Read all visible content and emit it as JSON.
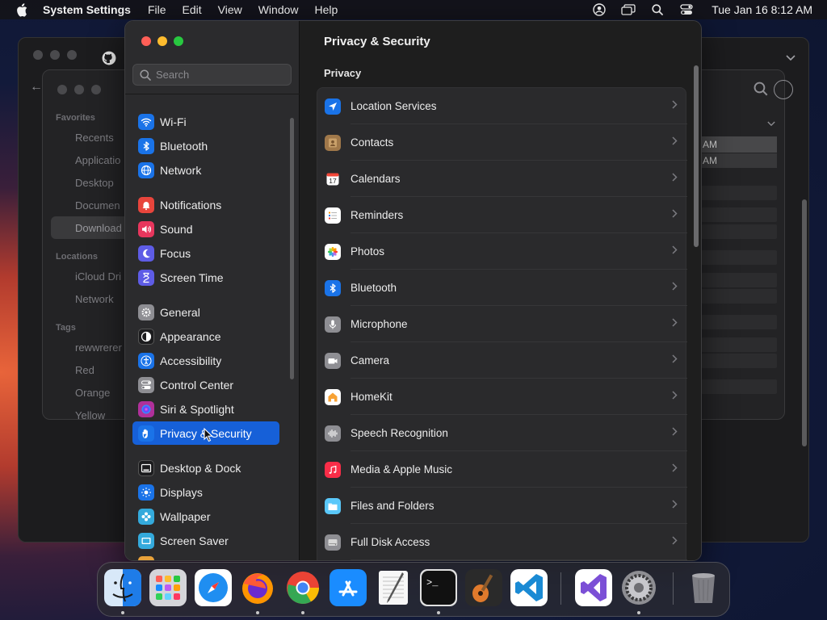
{
  "menubar": {
    "app_name": "System Settings",
    "menus": [
      "File",
      "Edit",
      "View",
      "Window",
      "Help"
    ],
    "clock": "Tue Jan 16  8:12 AM"
  },
  "background_finder": {
    "sidebar": [
      {
        "kind": "header",
        "label": "Favorites"
      },
      {
        "kind": "item",
        "label": "Recents"
      },
      {
        "kind": "item",
        "label": "Applicatio"
      },
      {
        "kind": "item",
        "label": "Desktop"
      },
      {
        "kind": "item",
        "label": "Documen"
      },
      {
        "kind": "item",
        "label": "Download"
      },
      {
        "kind": "header",
        "label": "Locations"
      },
      {
        "kind": "item",
        "label": "iCloud Dri"
      },
      {
        "kind": "item",
        "label": "Network"
      },
      {
        "kind": "header",
        "label": "Tags"
      },
      {
        "kind": "item",
        "label": "rewwrerer"
      },
      {
        "kind": "item",
        "label": "Red"
      },
      {
        "kind": "item",
        "label": "Orange"
      },
      {
        "kind": "item",
        "label": "Yellow"
      }
    ],
    "list_times": [
      "AM",
      "AM"
    ]
  },
  "settings": {
    "search_placeholder": "Search",
    "sidebar": [
      {
        "label": "Wi-Fi",
        "icon": "wifi-icon",
        "color": "#1a73e8"
      },
      {
        "label": "Bluetooth",
        "icon": "bluetooth-icon",
        "color": "#1a73e8"
      },
      {
        "label": "Network",
        "icon": "network-icon",
        "color": "#1a73e8"
      },
      {
        "label": "Notifications",
        "icon": "notifications-icon",
        "color": "#e8453c"
      },
      {
        "label": "Sound",
        "icon": "sound-icon",
        "color": "#e8365d"
      },
      {
        "label": "Focus",
        "icon": "focus-icon",
        "color": "#5e5ce6"
      },
      {
        "label": "Screen Time",
        "icon": "screen-time-icon",
        "color": "#5e5ce6"
      },
      {
        "label": "General",
        "icon": "general-icon",
        "color": "#8e8e93"
      },
      {
        "label": "Appearance",
        "icon": "appearance-icon",
        "color": "#1c1c1e"
      },
      {
        "label": "Accessibility",
        "icon": "accessibility-icon",
        "color": "#1a73e8"
      },
      {
        "label": "Control Center",
        "icon": "control-center-icon",
        "color": "#8e8e93"
      },
      {
        "label": "Siri & Spotlight",
        "icon": "siri-icon",
        "color": "#b0309b"
      },
      {
        "label": "Privacy & Security",
        "icon": "privacy-hand-icon",
        "color": "#1a73e8",
        "selected": true
      },
      {
        "label": "Desktop & Dock",
        "icon": "desktop-dock-icon",
        "color": "#1c1c1e"
      },
      {
        "label": "Displays",
        "icon": "displays-icon",
        "color": "#1a73e8"
      },
      {
        "label": "Wallpaper",
        "icon": "wallpaper-icon",
        "color": "#34aadc"
      },
      {
        "label": "Screen Saver",
        "icon": "screen-saver-icon",
        "color": "#34aadc"
      }
    ],
    "title": "Privacy & Security",
    "section": "Privacy",
    "rows": [
      {
        "label": "Location Services",
        "icon": "location-icon",
        "color": "#1a73e8"
      },
      {
        "label": "Contacts",
        "icon": "contacts-icon",
        "color": "#a0784a"
      },
      {
        "label": "Calendars",
        "icon": "calendar-icon",
        "color": "#ffffff",
        "glyph": "17"
      },
      {
        "label": "Reminders",
        "icon": "reminders-icon",
        "color": "#ffffff"
      },
      {
        "label": "Photos",
        "icon": "photos-icon",
        "color": "#ffffff"
      },
      {
        "label": "Bluetooth",
        "icon": "bluetooth-icon",
        "color": "#1a73e8"
      },
      {
        "label": "Microphone",
        "icon": "microphone-icon",
        "color": "#8e8e93"
      },
      {
        "label": "Camera",
        "icon": "camera-icon",
        "color": "#8e8e93"
      },
      {
        "label": "HomeKit",
        "icon": "homekit-icon",
        "color": "#ffffff"
      },
      {
        "label": "Speech Recognition",
        "icon": "speech-recognition-icon",
        "color": "#8e8e93"
      },
      {
        "label": "Media & Apple Music",
        "icon": "music-icon",
        "color": "#fa2d48"
      },
      {
        "label": "Files and Folders",
        "icon": "folder-icon",
        "color": "#5ac8fa"
      },
      {
        "label": "Full Disk Access",
        "icon": "disk-icon",
        "color": "#8e8e93"
      }
    ]
  },
  "dock": [
    {
      "name": "finder-icon",
      "color": "#1e7ce8",
      "running": true
    },
    {
      "name": "launchpad-icon",
      "color": "#b0b0b5",
      "running": false
    },
    {
      "name": "safari-icon",
      "color": "#1f8ef1",
      "running": false
    },
    {
      "name": "firefox-icon",
      "color": "#6a2bd0",
      "running": true
    },
    {
      "name": "chrome-icon",
      "color": "#ffffff",
      "running": true
    },
    {
      "name": "app-store-icon",
      "color": "#1a8cff",
      "running": false
    },
    {
      "name": "textedit-icon",
      "color": "#f2f2f2",
      "running": false
    },
    {
      "name": "terminal-icon",
      "color": "#111111",
      "running": true
    },
    {
      "name": "garageband-icon",
      "color": "#2a2a2a",
      "running": false
    },
    {
      "name": "vscode-icon",
      "color": "#ffffff",
      "running": false
    },
    {
      "name": "visual-studio-icon",
      "color": "#ffffff",
      "running": false
    },
    {
      "name": "system-settings-icon",
      "color": "#8e8e93",
      "running": true
    },
    {
      "name": "trash-icon",
      "color": "#5a5a5e",
      "running": false
    }
  ]
}
